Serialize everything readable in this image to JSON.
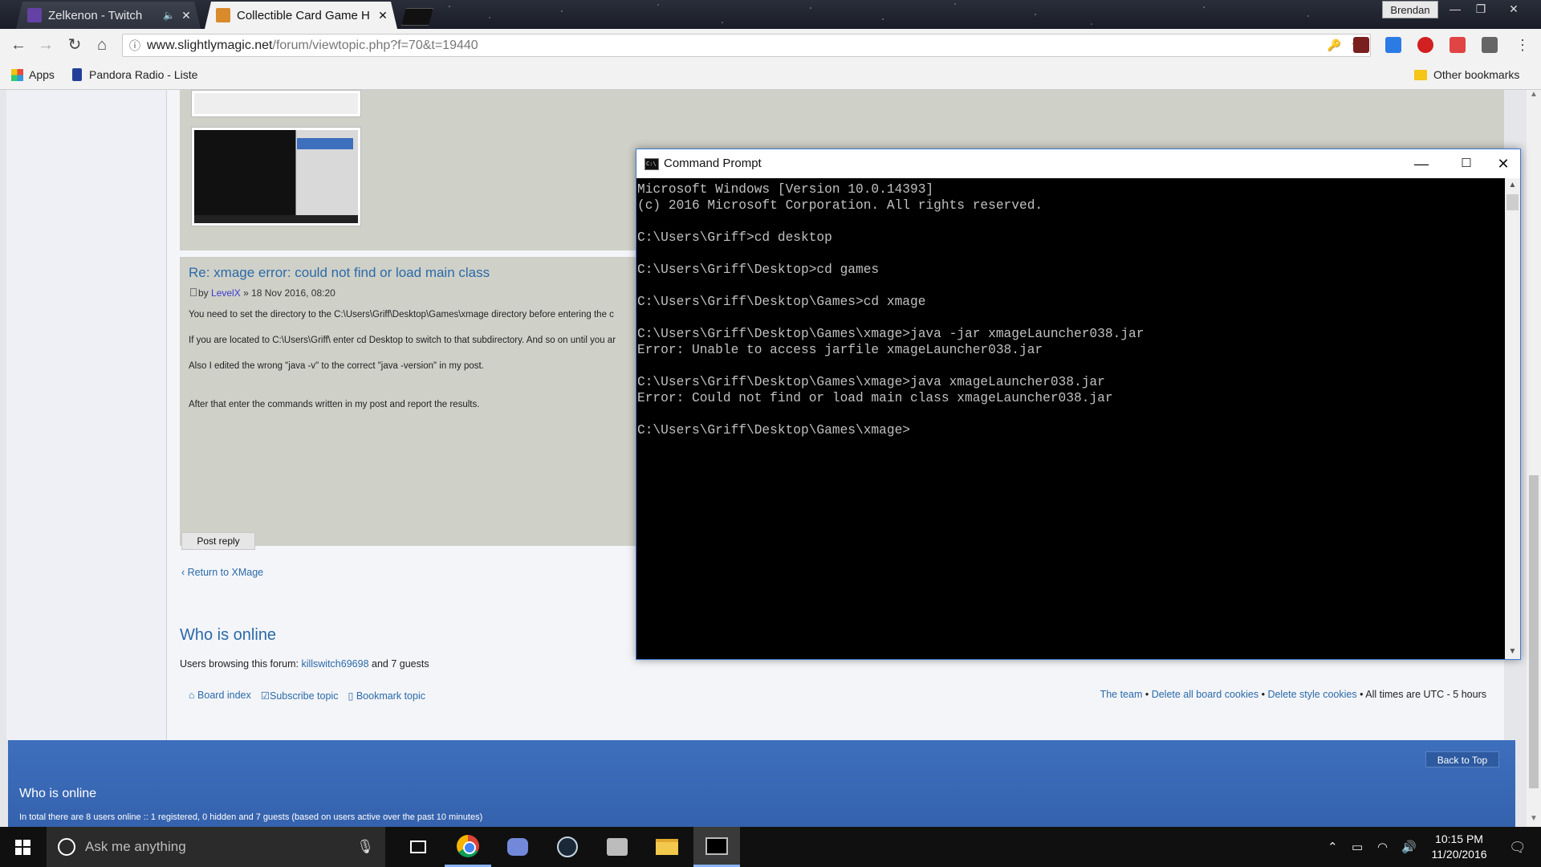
{
  "browser": {
    "tabs": [
      {
        "title": "Zelkenon - Twitch",
        "favicon_color": "#6441a4",
        "active": false,
        "audio": true
      },
      {
        "title": "Collectible Card Game H",
        "favicon_color": "#d98a2b",
        "active": true
      }
    ],
    "profile_name": "Brendan",
    "address": {
      "domain": "www.slightlymagic.net",
      "path": "/forum/viewtopic.php?f=70&t=19440"
    },
    "bookmarks": {
      "apps": "Apps",
      "pandora": "Pandora Radio - Liste",
      "other": "Other bookmarks"
    }
  },
  "forum": {
    "reply_title": "Re: xmage error: could not find or load main class",
    "reply_by": "by",
    "reply_author": "LevelX",
    "reply_date": "» 18 Nov 2016, 08:20",
    "lines": [
      "You need to set the directory to the C:\\Users\\Griff\\Desktop\\Games\\xmage directory before entering the c",
      "If you are located to C:\\Users\\Griff\\ enter cd Desktop to switch to that subdirectory. And so on until you ar",
      "Also I edited the wrong \"java -v\" to the correct \"java -version\" in my post.",
      "After that enter the commands written in my post and report the results."
    ],
    "post_reply_label": "Post reply",
    "return_label": "Return to XMage",
    "who_is_online": "Who is online",
    "users_prefix": "Users browsing this forum:",
    "users_user": "killswitch69698",
    "users_suffix": "and 7 guests",
    "footer_links": [
      "Board index",
      "Subscribe topic",
      "Bookmark topic"
    ],
    "footer_right": {
      "team": "The team",
      "delete_cookies": "Delete all board cookies",
      "delete_style": "Delete style cookies",
      "timezone": "All times are UTC - 5 hours"
    },
    "back_to_top": "Back to Top",
    "footer_who": "Who is online",
    "footer_total": "In total there are 8 users online :: 1 registered, 0 hidden and 7 guests (based on users active over the past 10 minutes)"
  },
  "cmd": {
    "title": "Command Prompt",
    "icon_text": "C:\\",
    "output": "Microsoft Windows [Version 10.0.14393]\n(c) 2016 Microsoft Corporation. All rights reserved.\n\nC:\\Users\\Griff>cd desktop\n\nC:\\Users\\Griff\\Desktop>cd games\n\nC:\\Users\\Griff\\Desktop\\Games>cd xmage\n\nC:\\Users\\Griff\\Desktop\\Games\\xmage>java -jar xmageLauncher038.jar\nError: Unable to access jarfile xmageLauncher038.jar\n\nC:\\Users\\Griff\\Desktop\\Games\\xmage>java xmageLauncher038.jar\nError: Could not find or load main class xmageLauncher038.jar\n\nC:\\Users\\Griff\\Desktop\\Games\\xmage>"
  },
  "taskbar": {
    "search_placeholder": "Ask me anything",
    "time": "10:15 PM",
    "date": "11/20/2016"
  }
}
